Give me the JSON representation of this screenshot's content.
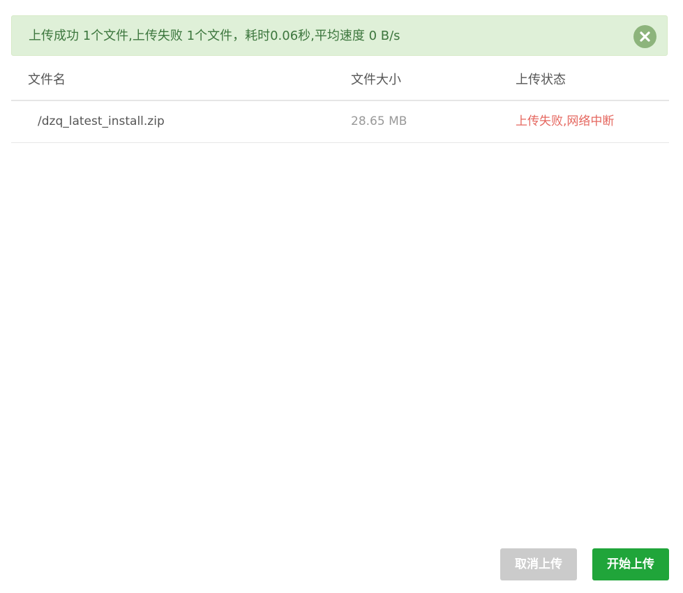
{
  "alert": {
    "message": "上传成功 1个文件,上传失败 1个文件，耗时0.06秒,平均速度 0 B/s",
    "close_icon": "close-icon"
  },
  "table": {
    "headers": {
      "name": "文件名",
      "size": "文件大小",
      "status": "上传状态"
    },
    "rows": [
      {
        "name": "/dzq_latest_install.zip",
        "size": "28.65 MB",
        "status": "上传失败,网络中断"
      }
    ]
  },
  "buttons": {
    "cancel": "取消上传",
    "start": "开始上传"
  },
  "colors": {
    "alert_bg": "#dff0d8",
    "alert_text": "#3c763d",
    "error": "#e5675f",
    "primary": "#20a53a",
    "disabled": "#cbcbcb"
  }
}
